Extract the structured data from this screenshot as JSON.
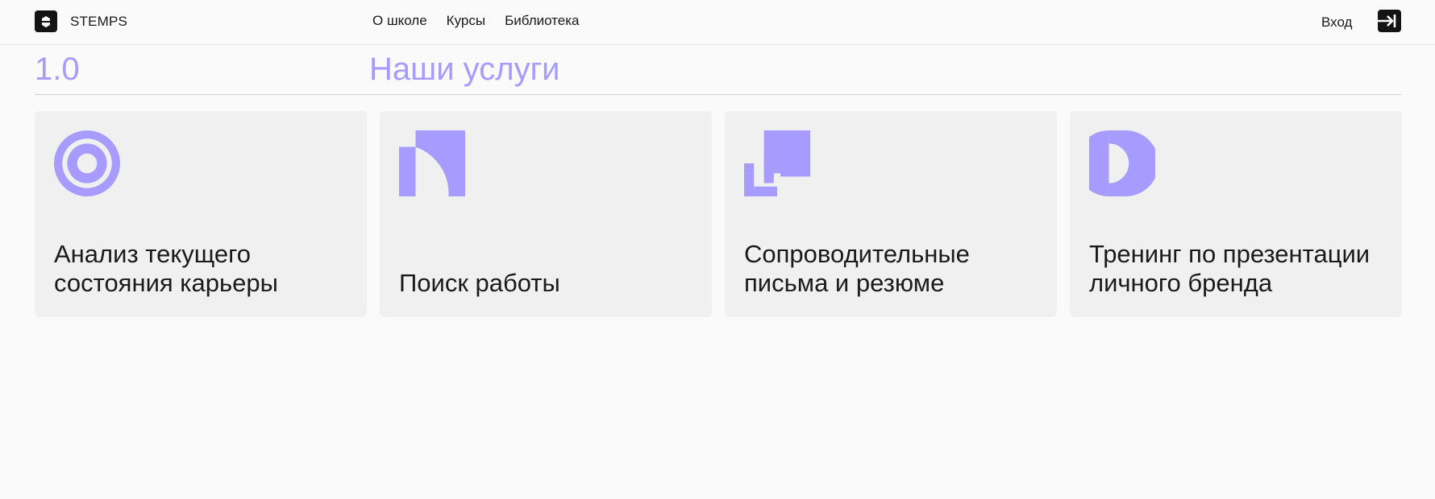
{
  "header": {
    "brand": "STEMPS",
    "nav": [
      "О школе",
      "Курсы",
      "Библиотека"
    ],
    "login": "Вход",
    "icons": {
      "logo": "stemps-logo-icon",
      "login": "login-arrow-icon"
    }
  },
  "section": {
    "number": "1.0",
    "title": "Наши услуги"
  },
  "cards": [
    {
      "title": "Анализ текущего состояния карьеры",
      "icon": "career-analysis-icon"
    },
    {
      "title": "Поиск работы",
      "icon": "job-search-icon"
    },
    {
      "title": "Сопроводительные письма и резюме",
      "icon": "cover-letters-icon"
    },
    {
      "title": "Тренинг по презентации личного бренда",
      "icon": "personal-brand-icon"
    }
  ],
  "colors": {
    "accent": "#a79bff",
    "dark": "#141414",
    "card_bg": "#f0f0f0",
    "page_bg": "#fafafa"
  }
}
